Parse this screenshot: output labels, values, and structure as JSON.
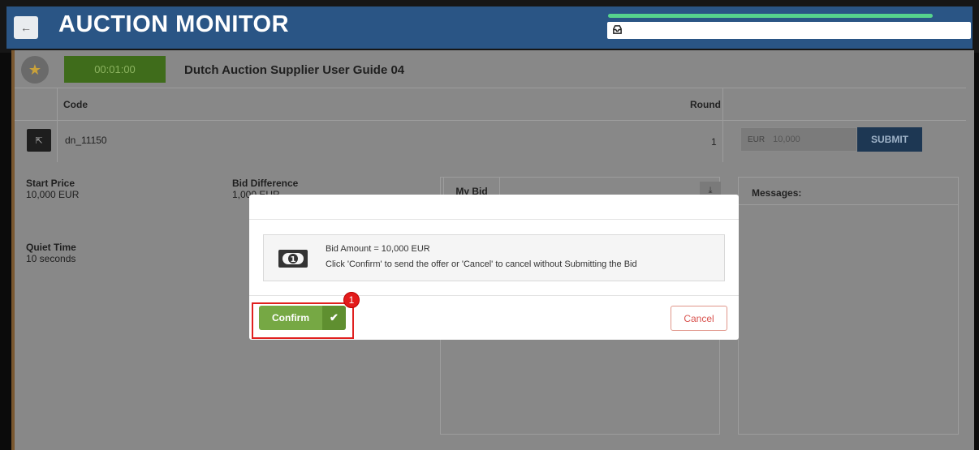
{
  "header": {
    "back_icon": "arrow-left-icon",
    "title": "AUCTION MONITOR",
    "inbox_icon": "inbox-icon",
    "brand_color": "#2a5585",
    "progress_color": "#56d38d"
  },
  "auction": {
    "favorite_icon": "star-icon",
    "timer": "00:01:00",
    "name": "Dutch Auction Supplier User Guide 04"
  },
  "table": {
    "headers": {
      "code": "Code",
      "round": "Round"
    },
    "row": {
      "code": "dn_11150",
      "round": "1"
    },
    "bid": {
      "currency": "EUR",
      "value": "10,000",
      "submit_label": "SUBMIT"
    }
  },
  "info": {
    "start_price_label": "Start Price",
    "start_price_value": "10,000 EUR",
    "bid_difference_label": "Bid Difference",
    "bid_difference_value": "1,000 EUR",
    "quiet_time_label": "Quiet Time",
    "quiet_time_value": "10 seconds"
  },
  "panels": {
    "my_bid_tab": "My Bid",
    "download_icon": "download-icon",
    "messages_label": "Messages:"
  },
  "modal": {
    "bid_amount": "Bid Amount = 10,000 EUR",
    "instruction": "Click 'Confirm' to send the offer or 'Cancel' to cancel without Submitting the Bid",
    "money_icon": "money-bill-icon",
    "confirm_label": "Confirm",
    "confirm_icon": "checkmark-icon",
    "cancel_label": "Cancel",
    "confirm_color": "#76a844",
    "cancel_color": "#d9534f"
  },
  "annotation": {
    "step_number": "1",
    "highlight_color": "#e0201f"
  }
}
